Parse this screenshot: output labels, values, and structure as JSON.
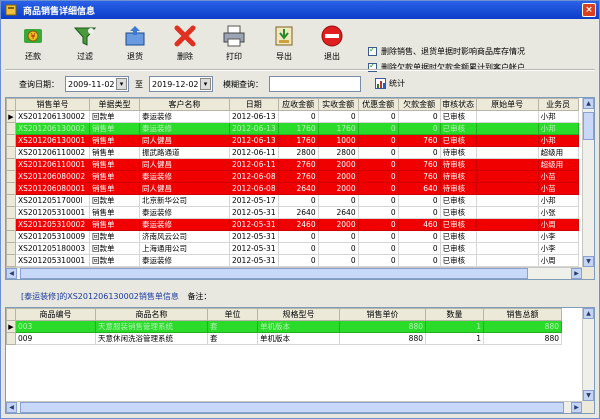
{
  "window": {
    "title": "商品销售详细信息",
    "close_glyph": "×"
  },
  "toolbar": {
    "buttons": [
      {
        "label": "还款"
      },
      {
        "label": "过滤"
      },
      {
        "label": "退货"
      },
      {
        "label": "删除"
      },
      {
        "label": "打印"
      },
      {
        "label": "导出"
      },
      {
        "label": "退出"
      }
    ],
    "options": [
      {
        "label": "删除销售、退货单据时影响商品库存情况",
        "checked": true
      },
      {
        "label": "删除欠款单据时欠款金额累计到客户帐户",
        "checked": true
      }
    ]
  },
  "query": {
    "date_label": "查询日期：",
    "start_date": "2009-11-02",
    "to_label": "至",
    "end_date": "2019-12-02",
    "fuzzy_label": "模糊查询：",
    "fuzzy_value": "",
    "stat_label": "统计",
    "date_btn_glyph": "▾"
  },
  "sales_grid": {
    "columns": [
      "销售单号",
      "单据类型",
      "客户名称",
      "日期",
      "应收金额",
      "实收金额",
      "优惠金额",
      "欠款金额",
      "审核状态",
      "原始单号",
      "业务员"
    ],
    "rows": [
      {
        "style": "",
        "cells": [
          "XS201206130002",
          "回款单",
          "泰运装修",
          "2012-06-13",
          "0",
          "0",
          "0",
          "0",
          "已审核",
          "",
          "小邦"
        ]
      },
      {
        "style": "green",
        "cells": [
          "XS201206130002",
          "销售单",
          "泰运装修",
          "2012-06-13",
          "1760",
          "1760",
          "0",
          "0",
          "已审核",
          "",
          "小邦"
        ]
      },
      {
        "style": "red",
        "cells": [
          "XS201206130001",
          "销售单",
          "同人健昌",
          "2012-06-13",
          "1760",
          "1000",
          "0",
          "760",
          "已审核",
          "",
          "小邦"
        ]
      },
      {
        "style": "",
        "cells": [
          "XS201206110002",
          "销售单",
          "振武路通道",
          "2012-06-11",
          "2800",
          "2800",
          "0",
          "0",
          "待审核",
          "",
          "超级用"
        ]
      },
      {
        "style": "red",
        "cells": [
          "XS201206110001",
          "销售单",
          "同人健昌",
          "2012-06-11",
          "2760",
          "2000",
          "0",
          "760",
          "待审核",
          "",
          "超级用"
        ]
      },
      {
        "style": "red",
        "cells": [
          "XS201206080002",
          "销售单",
          "泰运装修",
          "2012-06-08",
          "2760",
          "2000",
          "0",
          "760",
          "待审核",
          "",
          "小苗"
        ]
      },
      {
        "style": "red",
        "cells": [
          "XS201206080001",
          "销售单",
          "同人健昌",
          "2012-06-08",
          "2640",
          "2000",
          "0",
          "640",
          "待审核",
          "",
          "小苗"
        ]
      },
      {
        "style": "",
        "cells": [
          "XS20120517000l",
          "回款单",
          "北京新华公司",
          "2012-05-17",
          "0",
          "0",
          "0",
          "0",
          "已审核",
          "",
          "小邦"
        ]
      },
      {
        "style": "",
        "cells": [
          "XS201205310001",
          "销售单",
          "泰运装修",
          "2012-05-31",
          "2640",
          "2640",
          "0",
          "0",
          "已审核",
          "",
          "小张"
        ]
      },
      {
        "style": "red",
        "cells": [
          "XS201205310002",
          "销售单",
          "泰运装修",
          "2012-05-31",
          "2460",
          "2000",
          "0",
          "460",
          "已审核",
          "",
          "小周"
        ]
      },
      {
        "style": "",
        "cells": [
          "XS201205310009",
          "回款单",
          "济南风云公司",
          "2012-05-31",
          "0",
          "0",
          "0",
          "0",
          "已审核",
          "",
          "小李"
        ]
      },
      {
        "style": "",
        "cells": [
          "XS201205180003",
          "回款单",
          "上海通用公司",
          "2012-05-31",
          "0",
          "0",
          "0",
          "0",
          "已审核",
          "",
          "小李"
        ]
      },
      {
        "style": "",
        "cells": [
          "XS201205310001",
          "回款单",
          "泰运装修",
          "2012-05-31",
          "0",
          "0",
          "0",
          "0",
          "已审核",
          "",
          "小周"
        ]
      }
    ]
  },
  "detail_info": {
    "customer": "[泰运装修]",
    "text": "的XS201206130002销售单信息",
    "remark_label": "备注："
  },
  "detail_grid": {
    "columns": [
      "商品编号",
      "商品名称",
      "单位",
      "规格型号",
      "销售单价",
      "数量",
      "销售总额"
    ],
    "rows": [
      {
        "style": "green",
        "cells": [
          "003",
          "天意服装销售管理系统",
          "套",
          "单机版本",
          "880",
          "1",
          "880"
        ]
      },
      {
        "style": "",
        "cells": [
          "009",
          "天意休闲洗浴管理系统",
          "套",
          "单机版本",
          "880",
          "1",
          "880"
        ]
      }
    ]
  },
  "colors": {
    "title_bar": "#0a3cc8",
    "debt_row": "#f00000",
    "selected_row": "#2adb2a"
  },
  "icons": [
    "return-money-icon",
    "filter-icon",
    "return-goods-icon",
    "delete-icon",
    "print-icon",
    "export-icon",
    "exit-icon",
    "statistics-icon"
  ]
}
